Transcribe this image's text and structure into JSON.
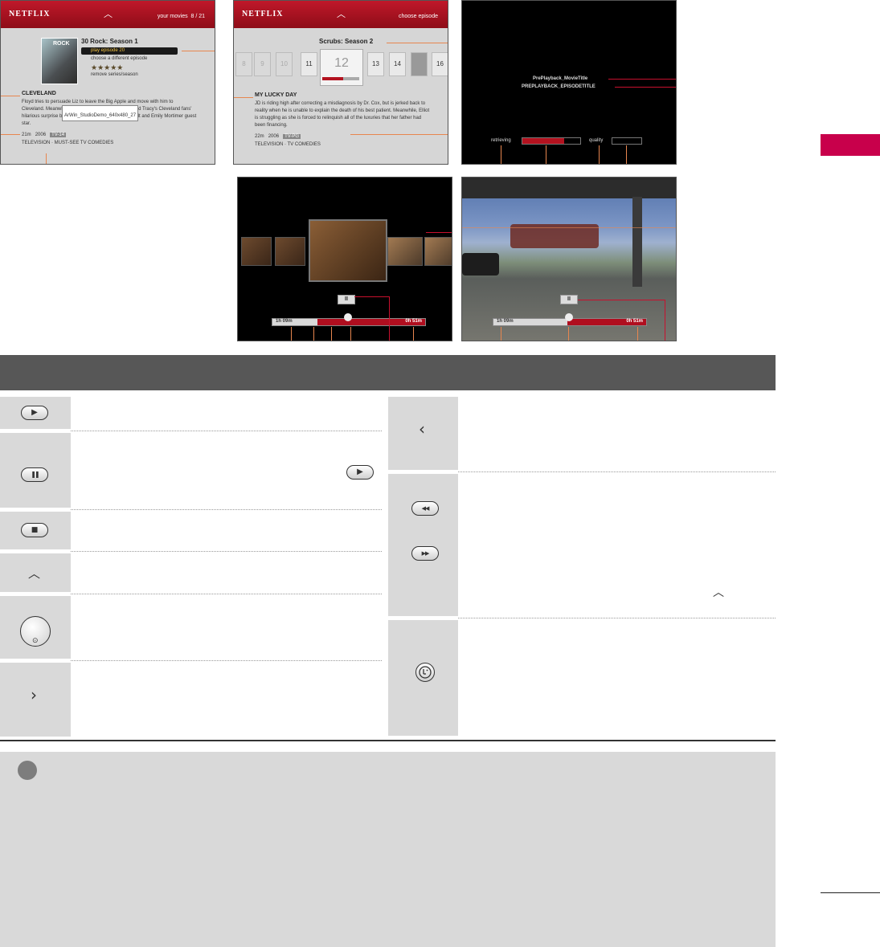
{
  "screens": {
    "netflix_movies": {
      "logo": "NETFLIX",
      "nav_label": "your movies",
      "count": "8 / 21",
      "show_title": "30 Rock: Season 1",
      "options": [
        "play episode 20",
        "choose a different episode",
        "★★★★★",
        "remove series/season"
      ],
      "poster_label": "ROCK",
      "episode_title": "CLEVELAND",
      "description": "Floyd tries to persuade Liz to leave the Big Apple and move with him to Cleveland. Meanwhile, Jack sends Tracy to Florida, and Tracy's Cleveland fans' hilarious surprise by the \"Black Crusaders.\" Lauren Holt and Emily Mortimer guest star.",
      "tooltip": "ArWin_StudioDemo_640x480_27",
      "meta": [
        "21m",
        "2006",
        "TV-14"
      ],
      "genre": "TELEVISION · MUST-SEE TV COMEDIES"
    },
    "netflix_episode": {
      "logo": "NETFLIX",
      "nav_label": "choose episode",
      "show_title": "Scrubs: Season 2",
      "episodes": [
        "8",
        "9",
        "10",
        "11",
        "12",
        "13",
        "14",
        "",
        "16"
      ],
      "episode_title": "MY LUCKY DAY",
      "description": "JD is riding high after correcting a misdiagnosis by Dr. Cox, but is jerked back to reality when he is unable to explain the death of his best patient. Meanwhile, Elliot is struggling as she is forced to relinquish all of the luxuries that her father had been financing.",
      "meta": [
        "22m",
        "2006",
        "TV-PG"
      ],
      "genre": "TELEVISION · TV COMEDIES"
    },
    "preplayback": {
      "movie_title": "PrePlayback_MovieTitle",
      "episode_title": "PREPLAYBACK_EPISODETITLE",
      "retrieving_label": "retrieving",
      "quality_label": "quality"
    },
    "scrub": {
      "time_left": "1h 09m",
      "time_right": "0h 51m",
      "pause": "II"
    },
    "playback": {
      "time_left": "1h 09m",
      "time_right": "0h 51m",
      "pause": "II"
    }
  },
  "icons": {
    "play": "▶",
    "pause": "❚❚",
    "stop": "■",
    "up": "︿",
    "left": "‹",
    "right": "›",
    "rewind": "◀◀",
    "fastforward": "▶▶"
  },
  "colors": {
    "netflix_red": "#b3121f",
    "accent_orange": "#e7864f",
    "section_header": "#575757",
    "side_tab": "#c8004b",
    "cell_gray": "#d9d9d9"
  }
}
